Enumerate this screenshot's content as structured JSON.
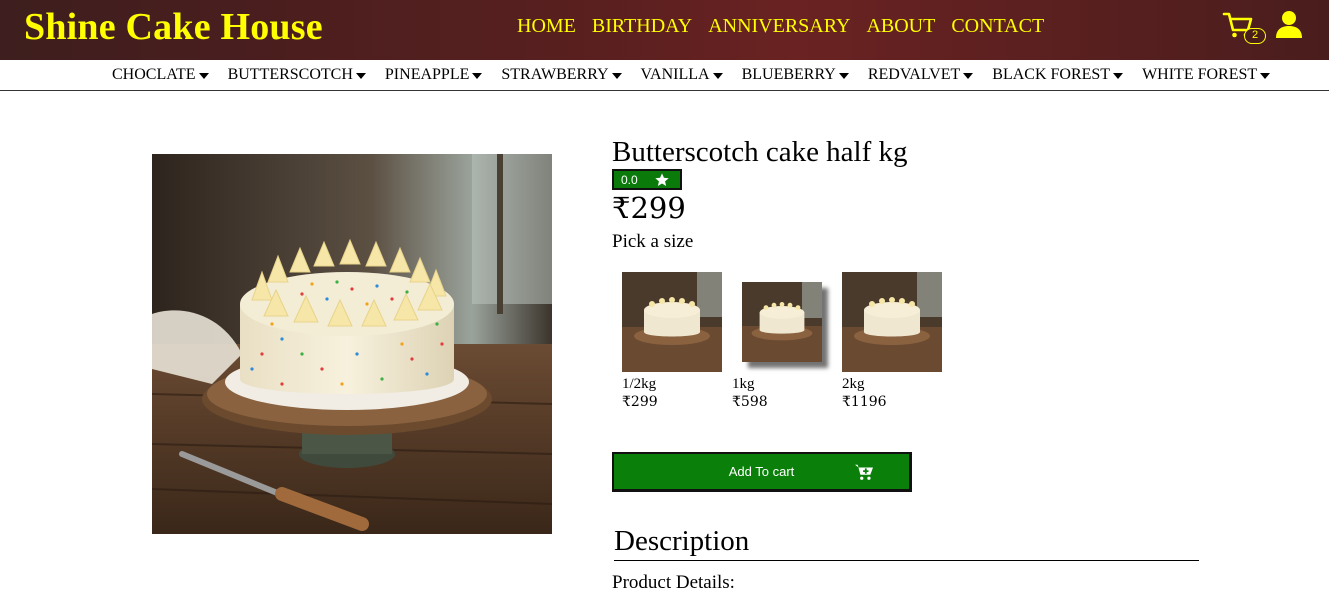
{
  "brand": {
    "name": "Shine Cake House"
  },
  "nav": {
    "items": [
      "HOME",
      "BIRTHDAY",
      "ANNIVERSARY",
      "ABOUT",
      "CONTACT"
    ]
  },
  "cart": {
    "count": "2",
    "icon": "cart-icon"
  },
  "user": {
    "icon": "user-icon"
  },
  "categories": [
    "CHOCLATE",
    "BUTTERSCOTCH",
    "PINEAPPLE",
    "STRAWBERRY",
    "VANILLA",
    "BLUEBERRY",
    "REDVALVET",
    "BLACK FOREST",
    "WHITE FOREST"
  ],
  "product": {
    "title": "Butterscotch cake half kg",
    "rating": "0.0",
    "price": "₹299",
    "pick_size_label": "Pick a size",
    "sizes": [
      {
        "label": "1/2kg",
        "price": "₹299"
      },
      {
        "label": "1kg",
        "price": "₹598"
      },
      {
        "label": "2kg",
        "price": "₹1196"
      }
    ],
    "add_to_cart_label": "Add To cart"
  },
  "description": {
    "heading": "Description",
    "details_label": "Product Details:"
  },
  "colors": {
    "header_bg": "#5a1f1f",
    "brand_text": "#ffff00",
    "button_green": "#0a800a",
    "rating_green": "#0a7a0a"
  }
}
